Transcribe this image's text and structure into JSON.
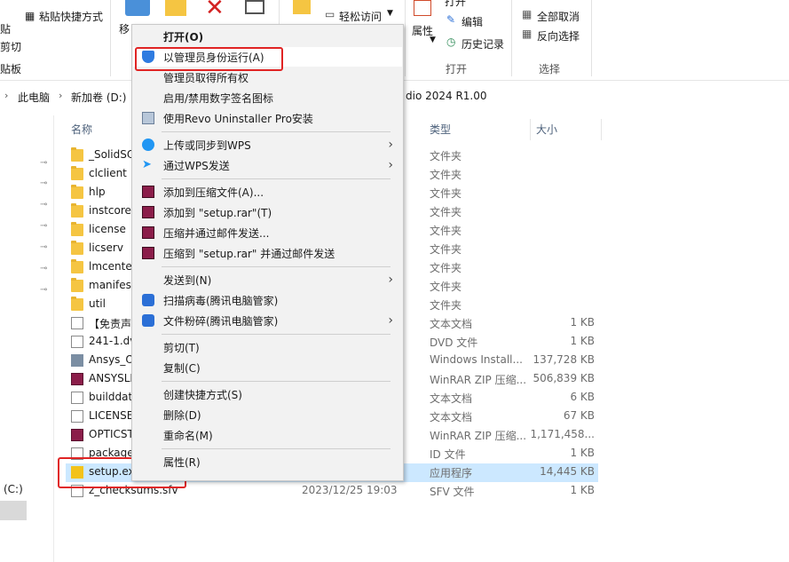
{
  "ribbon": {
    "paste_shortcut": "粘贴快捷方式",
    "clip_paste": "贴",
    "clip_cut": "剪切",
    "clip_board": "贴板",
    "move_to": "移",
    "easy_access": "轻松访问",
    "properties": "属性",
    "open": "打开",
    "edit": "编辑",
    "history": "历史记录",
    "select_none": "全部取消",
    "invert_selection": "反向选择",
    "group_open": "打开",
    "group_select": "选择"
  },
  "address": {
    "this_pc": "此电脑",
    "drive": "新加卷 (D:)",
    "folder_tail": "dio 2024 R1.00"
  },
  "columns": {
    "name": "名称",
    "type": "类型",
    "size": "大小"
  },
  "left_nav": {
    "drive_c": "(C:)"
  },
  "files": [
    {
      "name": "_SolidSQ",
      "date": "",
      "type": "文件夹",
      "size": "",
      "icon": "folder-icon"
    },
    {
      "name": "clclient",
      "date": "",
      "type": "文件夹",
      "size": "",
      "icon": "folder-icon"
    },
    {
      "name": "hlp",
      "date": "",
      "type": "文件夹",
      "size": "",
      "icon": "folder-icon"
    },
    {
      "name": "instcore",
      "date": "",
      "type": "文件夹",
      "size": "",
      "icon": "folder-icon"
    },
    {
      "name": "license",
      "date": "",
      "type": "文件夹",
      "size": "",
      "icon": "folder-icon"
    },
    {
      "name": "licserv",
      "date": "",
      "type": "文件夹",
      "size": "",
      "icon": "folder-icon"
    },
    {
      "name": "lmcenter",
      "date": "",
      "type": "文件夹",
      "size": "",
      "icon": "folder-icon"
    },
    {
      "name": "manifest",
      "date": "",
      "type": "文件夹",
      "size": "",
      "icon": "folder-icon"
    },
    {
      "name": "util",
      "date": "",
      "type": "文件夹",
      "size": "",
      "icon": "folder-icon"
    },
    {
      "name": "【免责声",
      "date": "",
      "type": "文本文档",
      "size": "1 KB",
      "icon": "text-file-icon"
    },
    {
      "name": "241-1.dvd",
      "date": "",
      "type": "DVD 文件",
      "size": "1 KB",
      "icon": "text-file-icon"
    },
    {
      "name": "Ansys_O",
      "date": "",
      "type": "Windows Install...",
      "size": "137,728 KB",
      "icon": "installer-icon"
    },
    {
      "name": "ANSYSLI",
      "date": "",
      "type": "WinRAR ZIP 压缩...",
      "size": "506,839 KB",
      "icon": "rar-archive-icon"
    },
    {
      "name": "builddat",
      "date": "",
      "type": "文本文档",
      "size": "6 KB",
      "icon": "text-file-icon"
    },
    {
      "name": "LICENSE",
      "date": "",
      "type": "文本文档",
      "size": "67 KB",
      "icon": "text-file-icon"
    },
    {
      "name": "OPTICST",
      "date": "",
      "type": "WinRAR ZIP 压缩...",
      "size": "1,171,458...",
      "icon": "rar-archive-icon"
    },
    {
      "name": "package",
      "date": "",
      "type": "ID 文件",
      "size": "1 KB",
      "icon": "text-file-icon"
    },
    {
      "name": "setup.exe",
      "date": "",
      "type": "应用程序",
      "size": "14,445 KB",
      "icon": "setup-exe-icon"
    },
    {
      "name": "z_checksums.sfv",
      "date": "2023/12/25 19:03",
      "type": "SFV 文件",
      "size": "1 KB",
      "icon": "text-file-icon"
    }
  ],
  "context_menu": {
    "open": "打开(O)",
    "run_as_admin": "以管理员身份运行(A)",
    "take_ownership": "管理员取得所有权",
    "toggle_signature": "启用/禁用数字签名图标",
    "revo_install": "使用Revo Uninstaller Pro安装",
    "wps_upload": "上传或同步到WPS",
    "wps_send": "通过WPS发送",
    "add_archive": "添加到压缩文件(A)...",
    "add_setup_rar": "添加到 \"setup.rar\"(T)",
    "compress_email": "压缩并通过邮件发送...",
    "compress_setup_email": "压缩到 \"setup.rar\" 并通过邮件发送",
    "send_to": "发送到(N)",
    "tencent_scan": "扫描病毒(腾讯电脑管家)",
    "tencent_shred": "文件粉碎(腾讯电脑管家)",
    "cut": "剪切(T)",
    "copy": "复制(C)",
    "create_shortcut": "创建快捷方式(S)",
    "delete": "删除(D)",
    "rename": "重命名(M)",
    "properties": "属性(R)"
  },
  "colors": {
    "highlight": "#e02424",
    "selection": "#cce8ff",
    "menu_bg": "#f2f2f2"
  }
}
